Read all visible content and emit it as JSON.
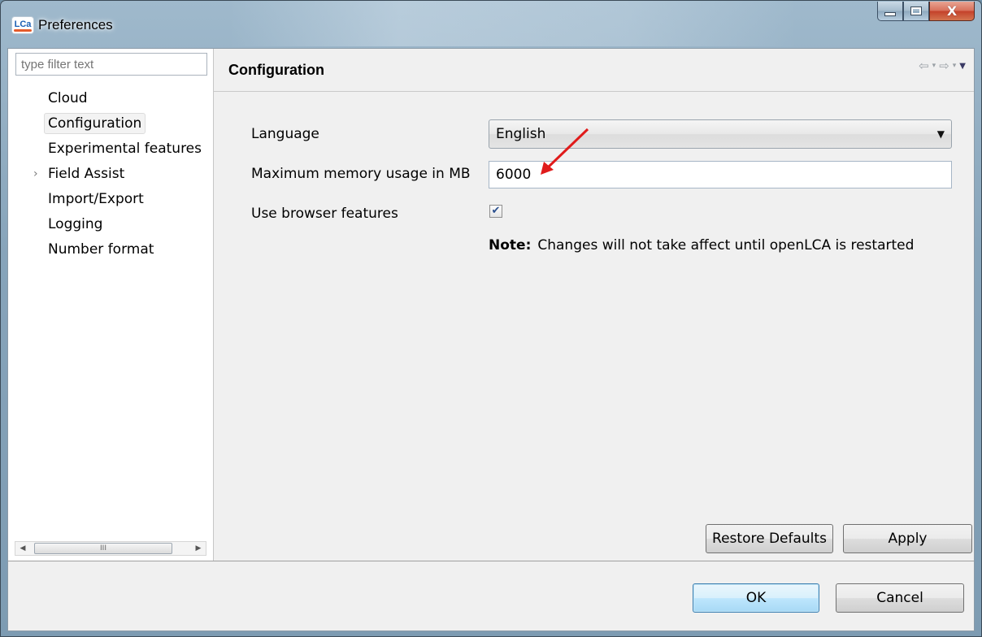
{
  "window": {
    "title": "Preferences",
    "icon_label": "LCa",
    "controls": {
      "minimize": "minimize-icon",
      "maximize": "maximize-icon",
      "close": "X"
    }
  },
  "sidebar": {
    "filter_placeholder": "type filter text",
    "items": [
      {
        "label": "Cloud"
      },
      {
        "label": "Configuration",
        "selected": true
      },
      {
        "label": "Experimental features"
      },
      {
        "label": "Field Assist",
        "expander": "›"
      },
      {
        "label": "Import/Export"
      },
      {
        "label": "Logging"
      },
      {
        "label": "Number format"
      }
    ],
    "scrollbar": {
      "left_arrow": "◀",
      "thumb_grip": "III",
      "right_arrow": "▶"
    }
  },
  "page": {
    "title": "Configuration",
    "nav": {
      "back": "⇦",
      "forward": "⇨",
      "dropdown": "▾",
      "menu": "▼"
    },
    "language_label": "Language",
    "language_value": "English",
    "memory_label": "Maximum memory usage in MB",
    "memory_value": "6000",
    "browser_label": "Use browser features",
    "browser_checked": true,
    "note_label": "Note:",
    "note_text": "Changes will not take affect until openLCA is restarted",
    "restore_label": "Restore Defaults",
    "apply_label": "Apply"
  },
  "footer": {
    "ok_label": "OK",
    "cancel_label": "Cancel"
  },
  "colors": {
    "annotation_arrow": "#e01b1b",
    "default_button_border": "#3c7fb1"
  }
}
